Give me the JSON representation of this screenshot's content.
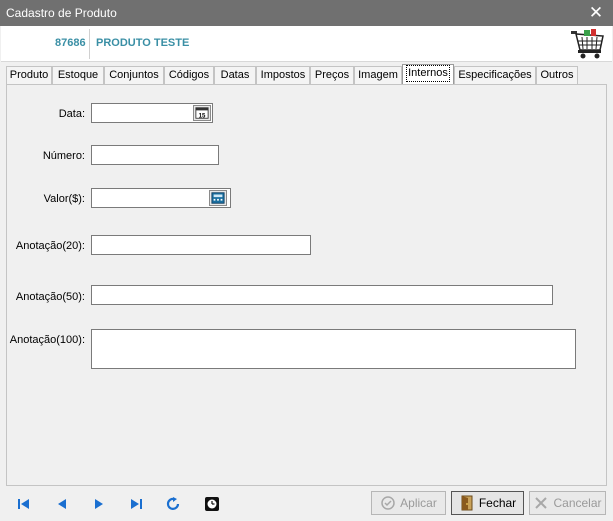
{
  "window": {
    "title": "Cadastro de Produto",
    "close_glyph": "✕"
  },
  "header": {
    "code": "87686",
    "name": "PRODUTO TESTE",
    "logo_icon": "shopping-cart-icon"
  },
  "tabs": [
    {
      "label": "Produto",
      "active": false
    },
    {
      "label": "Estoque",
      "active": false
    },
    {
      "label": "Conjuntos",
      "active": false
    },
    {
      "label": "Códigos",
      "active": false
    },
    {
      "label": "Datas",
      "active": false
    },
    {
      "label": "Impostos",
      "active": false
    },
    {
      "label": "Preços",
      "active": false
    },
    {
      "label": "Imagem",
      "active": false
    },
    {
      "label": "Internos",
      "active": true
    },
    {
      "label": "Especificações",
      "active": false
    },
    {
      "label": "Outros",
      "active": false
    }
  ],
  "form": {
    "data_label": "Data:",
    "data_value": "",
    "numero_label": "Número:",
    "numero_value": "",
    "valor_label": "Valor($):",
    "valor_value": "",
    "anotacao20_label": "Anotação(20):",
    "anotacao20_value": "",
    "anotacao50_label": "Anotação(50):",
    "anotacao50_value": "",
    "anotacao100_label": "Anotação(100):",
    "anotacao100_value": ""
  },
  "footer": {
    "aplicar_label": "Aplicar",
    "fechar_label": "Fechar",
    "cancelar_label": "Cancelar"
  },
  "colors": {
    "accent": "#3a8fa5",
    "nav_blue": "#1a6fd0",
    "titlebar": "#707070"
  }
}
